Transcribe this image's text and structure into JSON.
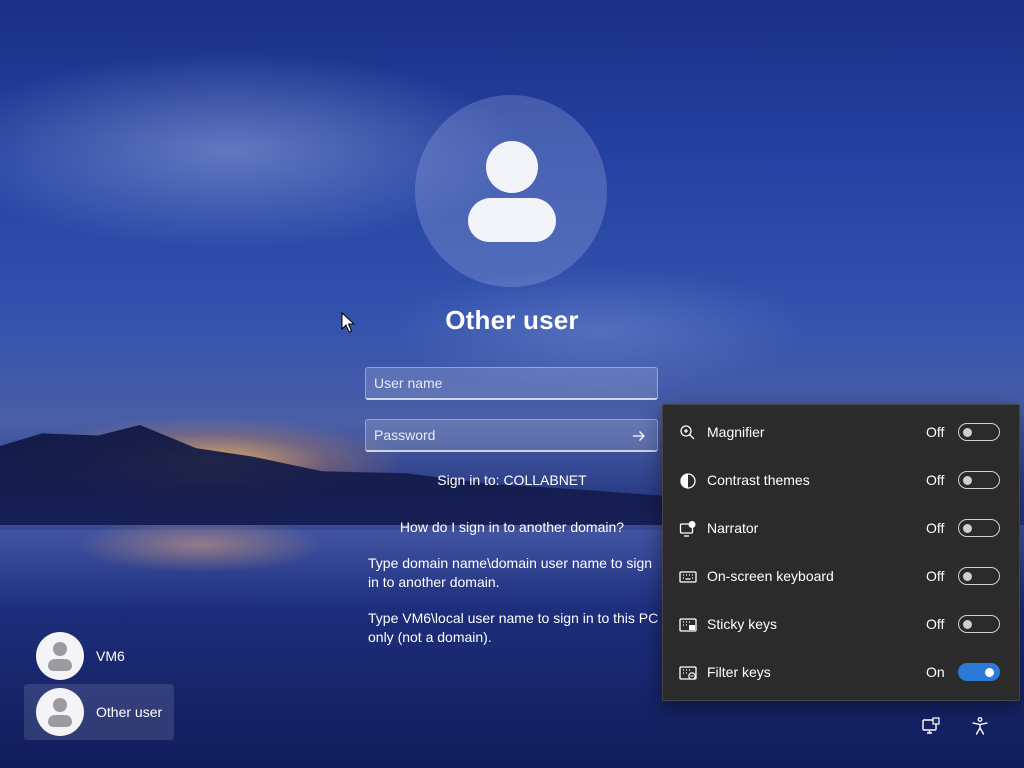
{
  "login": {
    "title": "Other user",
    "username_placeholder": "User name",
    "password_placeholder": "Password",
    "sign_in_to": "Sign in to: COLLABNET",
    "help_link": "How do I sign in to another domain?",
    "help_text_1": "Type domain name\\domain user name to sign in to another domain.",
    "help_text_2": "Type VM6\\local user name to sign in to this PC only (not a domain)."
  },
  "users": [
    {
      "name": "VM6"
    },
    {
      "name": "Other user"
    }
  ],
  "accessibility": {
    "items": [
      {
        "label": "Magnifier",
        "state": "Off",
        "on": false,
        "icon": "magnifier-icon"
      },
      {
        "label": "Contrast themes",
        "state": "Off",
        "on": false,
        "icon": "contrast-icon"
      },
      {
        "label": "Narrator",
        "state": "Off",
        "on": false,
        "icon": "narrator-icon"
      },
      {
        "label": "On-screen keyboard",
        "state": "Off",
        "on": false,
        "icon": "keyboard-icon"
      },
      {
        "label": "Sticky keys",
        "state": "Off",
        "on": false,
        "icon": "sticky-keys-icon"
      },
      {
        "label": "Filter keys",
        "state": "On",
        "on": true,
        "icon": "filter-keys-icon"
      }
    ]
  },
  "colors": {
    "toggle_on": "#2b7bd6",
    "panel_bg": "#2b2b2b"
  }
}
